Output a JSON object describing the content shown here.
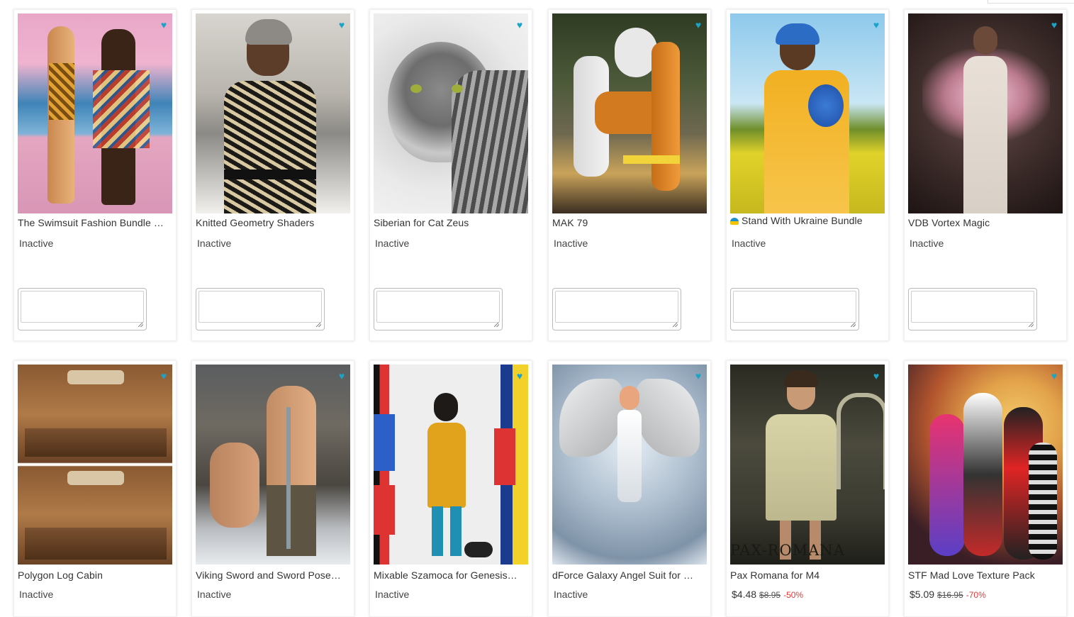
{
  "cards": [
    {
      "title": "The Swimsuit Fashion Bundle …",
      "status": "Inactive"
    },
    {
      "title": "Knitted Geometry Shaders",
      "status": "Inactive"
    },
    {
      "title": "Siberian for Cat Zeus",
      "status": "Inactive"
    },
    {
      "title": "MAK 79",
      "status": "Inactive"
    },
    {
      "title": "Stand With Ukraine Bundle",
      "status": "Inactive"
    },
    {
      "title": "VDB Vortex Magic",
      "status": "Inactive"
    },
    {
      "title": "Polygon Log Cabin",
      "status": "Inactive"
    },
    {
      "title": "Viking Sword and Sword Pose…",
      "status": "Inactive"
    },
    {
      "title": "Mixable Szamoca for Genesis…",
      "status": "Inactive"
    },
    {
      "title": "dForce Galaxy Angel Suit for …",
      "status": "Inactive"
    },
    {
      "title": "Pax Romana for M4",
      "price": "$4.48",
      "old_price": "$8.95",
      "discount": "-50%"
    },
    {
      "title": "STF Mad Love Texture Pack",
      "price": "$5.09",
      "old_price": "$16.95",
      "discount": "-70%"
    }
  ],
  "image_texts": {
    "pax_romana": "PAX-ROMANA"
  },
  "colors": {
    "accent": "#1aa4c8",
    "discount": "#e03a3a"
  },
  "icons": {
    "favorite": "heart-icon"
  }
}
